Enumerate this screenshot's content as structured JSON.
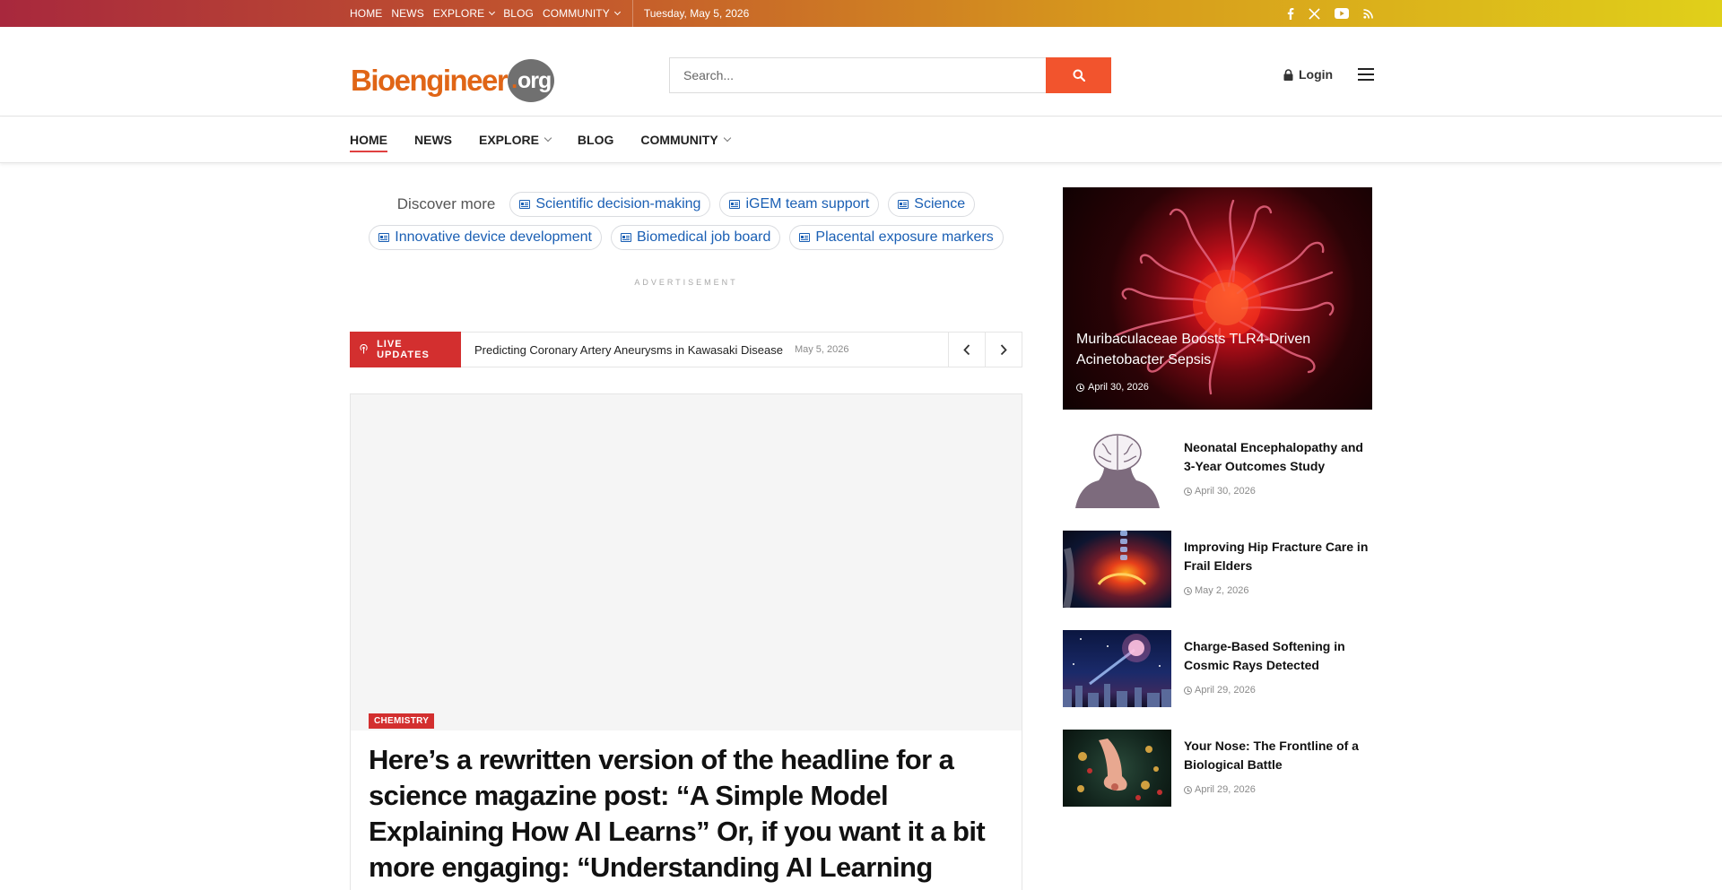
{
  "topbar": {
    "nav": [
      {
        "label": "HOME",
        "dropdown": false
      },
      {
        "label": "NEWS",
        "dropdown": false
      },
      {
        "label": "EXPLORE",
        "dropdown": true
      },
      {
        "label": "BLOG",
        "dropdown": false
      },
      {
        "label": "COMMUNITY",
        "dropdown": true
      }
    ],
    "date": "Tuesday, May 5, 2026",
    "social_icons": [
      "facebook-icon",
      "x-icon",
      "youtube-icon",
      "rss-icon"
    ]
  },
  "header": {
    "logo_main": "Bioengineer",
    "logo_dot": ".",
    "logo_org": "org",
    "search_placeholder": "Search...",
    "login_label": "Login"
  },
  "mainnav": {
    "items": [
      {
        "label": "HOME",
        "active": true,
        "dropdown": false
      },
      {
        "label": "NEWS",
        "active": false,
        "dropdown": false
      },
      {
        "label": "EXPLORE",
        "active": false,
        "dropdown": true
      },
      {
        "label": "BLOG",
        "active": false,
        "dropdown": false
      },
      {
        "label": "COMMUNITY",
        "active": false,
        "dropdown": true
      }
    ]
  },
  "discover": {
    "label": "Discover more",
    "chips_row1": [
      "Scientific decision-making",
      "iGEM team support",
      "Science"
    ],
    "chips_row2": [
      "Innovative device development",
      "Biomedical job board",
      "Placental exposure markers"
    ]
  },
  "advertisement_label": "ADVERTISEMENT",
  "ticker": {
    "badge": "LIVE UPDATES",
    "title": "Predicting Coronary Artery Aneurysms in Kawasaki Disease",
    "date": "May 5, 2026"
  },
  "feature": {
    "category": "CHEMISTRY",
    "title": "Here’s a rewritten version of the headline for a science magazine post: “A Simple Model Explaining How AI Learns” Or, if you want it a bit more engaging: “Understanding AI Learning"
  },
  "sidebar": {
    "hero": {
      "title": "Muribaculaceae Boosts TLR4-Driven Acinetobacter Sepsis",
      "date": "April 30, 2026"
    },
    "items": [
      {
        "title": "Neonatal Encephalopathy and 3-Year Outcomes Study",
        "date": "April 30, 2026"
      },
      {
        "title": "Improving Hip Fracture Care in Frail Elders",
        "date": "May 2, 2026"
      },
      {
        "title": "Charge-Based Softening in Cosmic Rays Detected",
        "date": "April 29, 2026"
      },
      {
        "title": "Your Nose: The Frontline of a Biological Battle",
        "date": "April 29, 2026"
      }
    ]
  },
  "colors": {
    "accent_red": "#d32f2f",
    "search_button": "#f2542d",
    "logo_orange": "#e06516",
    "link_blue": "#1a5fb4"
  }
}
